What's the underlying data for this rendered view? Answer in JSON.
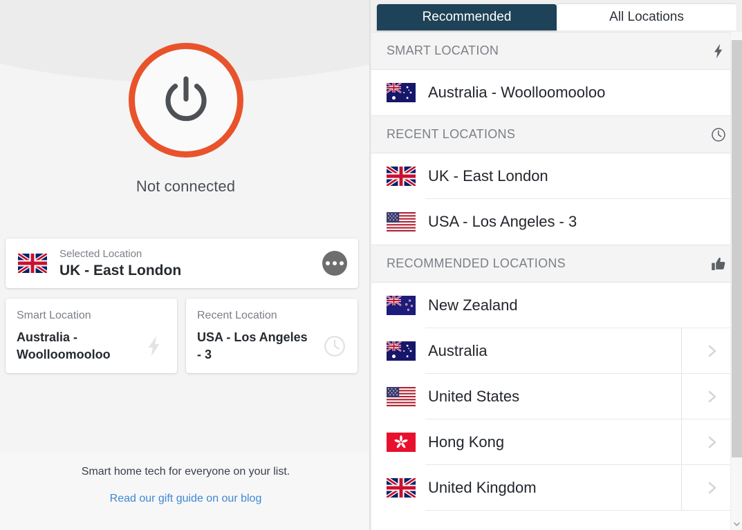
{
  "left": {
    "power_button": {
      "icon": "power-icon",
      "ring_color": "#e8532c"
    },
    "connection_status": "Not connected",
    "selected_card": {
      "label": "Selected Location",
      "value": "UK - East London",
      "flag": "uk-flag",
      "menu_icon": "more-options-icon"
    },
    "smart_card": {
      "label": "Smart Location",
      "value": "Australia - Woolloomooloo",
      "icon": "lightning-bolt-icon"
    },
    "recent_card": {
      "label": "Recent Location",
      "value": "USA - Los Angeles - 3",
      "icon": "clock-icon"
    },
    "promo": {
      "text": "Smart home tech for everyone on your list.",
      "link": "Read our gift guide on our blog",
      "link_color": "#3c87d6"
    }
  },
  "right": {
    "tabs": [
      {
        "label": "Recommended",
        "active": true
      },
      {
        "label": "All Locations",
        "active": false
      }
    ],
    "sections": [
      {
        "title": "SMART LOCATION",
        "icon": "lightning-bolt-icon",
        "items": [
          {
            "name": "Australia - Woolloomooloo",
            "flag": "au-flag",
            "chevron": false
          }
        ]
      },
      {
        "title": "RECENT LOCATIONS",
        "icon": "clock-icon",
        "items": [
          {
            "name": "UK - East London",
            "flag": "uk-flag",
            "chevron": false
          },
          {
            "name": "USA - Los Angeles - 3",
            "flag": "us-flag",
            "chevron": false
          }
        ]
      },
      {
        "title": "RECOMMENDED LOCATIONS",
        "icon": "thumbs-up-icon",
        "items": [
          {
            "name": "New Zealand",
            "flag": "nz-flag",
            "chevron": false
          },
          {
            "name": "Australia",
            "flag": "au-flag",
            "chevron": true
          },
          {
            "name": "United States",
            "flag": "us-flag",
            "chevron": true
          },
          {
            "name": "Hong Kong",
            "flag": "hk-flag",
            "chevron": true
          },
          {
            "name": "United Kingdom",
            "flag": "uk-flag",
            "chevron": true
          }
        ]
      }
    ],
    "scrollbar": {
      "name": "vertical-scrollbar"
    }
  },
  "colors": {
    "tab_active_bg": "#1e4258",
    "power_ring": "#e8532c",
    "link": "#3c87d6",
    "section_label": "#7b7f86"
  }
}
